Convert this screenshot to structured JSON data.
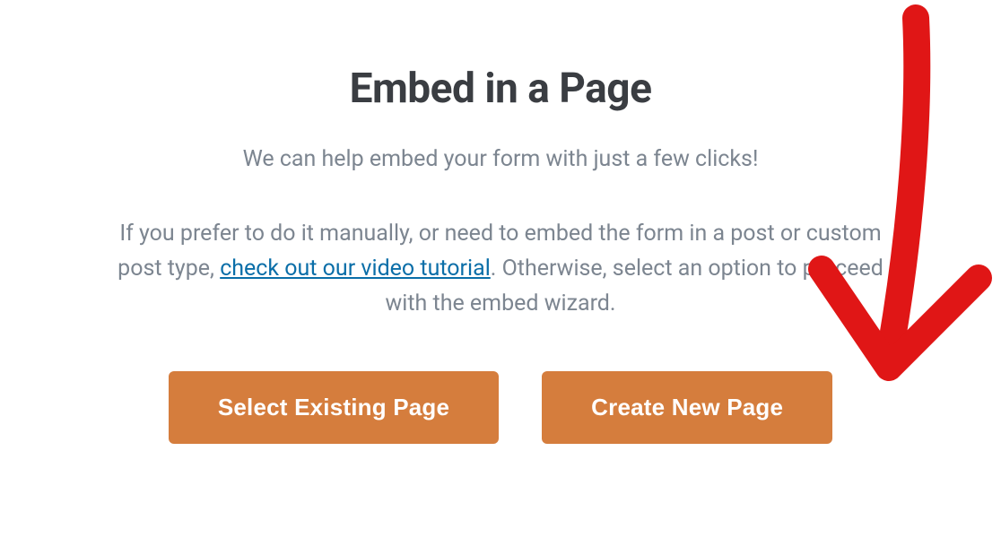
{
  "modal": {
    "title": "Embed in a Page",
    "subtitle": "We can help embed your form with just a few clicks!",
    "paragraph_pre": "If you prefer to do it manually, or need to embed the form in a post or custom post type, ",
    "link_text": "check out our video tutorial",
    "paragraph_post": ". Otherwise, select an option to proceed with the embed wizard.",
    "buttons": {
      "existing": "Select Existing Page",
      "create": "Create New Page"
    }
  },
  "annotation": {
    "arrow_color": "#e01616"
  }
}
